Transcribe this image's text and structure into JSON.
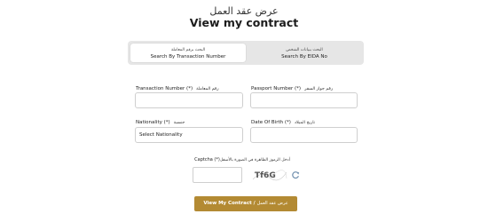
{
  "header": {
    "title_ar": "عرض عقد العمل",
    "title_en": "View my contract"
  },
  "tabs": [
    {
      "label_ar": "البحث برقم المعاملة",
      "label_en": "Search By Transaction Number",
      "active": true
    },
    {
      "label_ar": "البحث ببيانات الشخص",
      "label_en": "Search By EIDA No",
      "active": false
    }
  ],
  "form": {
    "transaction_number": {
      "label_en": "Transaction Number (*)",
      "label_ar": "رقم المعاملة",
      "value": ""
    },
    "passport_number": {
      "label_en": "Passport Number (*)",
      "label_ar": "رقم جواز السفر",
      "value": ""
    },
    "nationality": {
      "label_en": "Nationality (*)",
      "label_ar": "جنسية",
      "selected": "Select Nationality"
    },
    "date_of_birth": {
      "label_en": "Date Of Birth (*)",
      "label_ar": "تاريخ الميلاد",
      "value": ""
    }
  },
  "captcha": {
    "label_en": "Captcha (*)",
    "label_ar": "أدخل الرموز الظاهرة في الصورة بالأسفل",
    "code": "Tf6G",
    "value": ""
  },
  "submit": {
    "label_en": "View My Contract /",
    "label_ar": "عرض عقد العمل"
  },
  "icons": {
    "refresh": "refresh-icon"
  },
  "colors": {
    "accent": "#b38a33",
    "refresh_icon": "#6f8fae",
    "tab_bar": "#e6e6e6"
  }
}
